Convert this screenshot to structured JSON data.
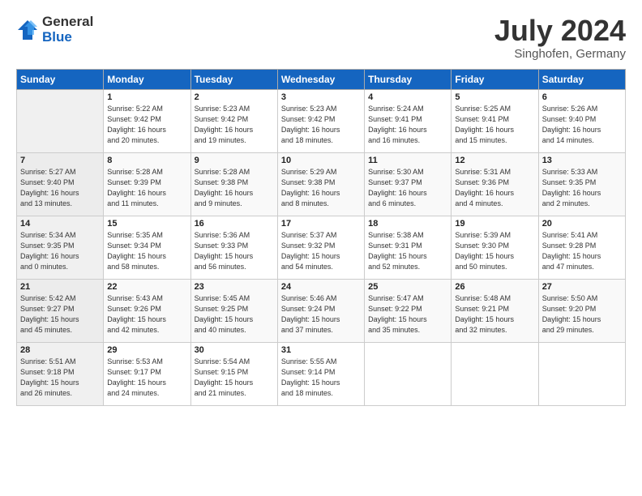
{
  "logo": {
    "general": "General",
    "blue": "Blue"
  },
  "title": "July 2024",
  "location": "Singhofen, Germany",
  "days_header": [
    "Sunday",
    "Monday",
    "Tuesday",
    "Wednesday",
    "Thursday",
    "Friday",
    "Saturday"
  ],
  "weeks": [
    [
      {
        "num": "",
        "info": ""
      },
      {
        "num": "1",
        "info": "Sunrise: 5:22 AM\nSunset: 9:42 PM\nDaylight: 16 hours\nand 20 minutes."
      },
      {
        "num": "2",
        "info": "Sunrise: 5:23 AM\nSunset: 9:42 PM\nDaylight: 16 hours\nand 19 minutes."
      },
      {
        "num": "3",
        "info": "Sunrise: 5:23 AM\nSunset: 9:42 PM\nDaylight: 16 hours\nand 18 minutes."
      },
      {
        "num": "4",
        "info": "Sunrise: 5:24 AM\nSunset: 9:41 PM\nDaylight: 16 hours\nand 16 minutes."
      },
      {
        "num": "5",
        "info": "Sunrise: 5:25 AM\nSunset: 9:41 PM\nDaylight: 16 hours\nand 15 minutes."
      },
      {
        "num": "6",
        "info": "Sunrise: 5:26 AM\nSunset: 9:40 PM\nDaylight: 16 hours\nand 14 minutes."
      }
    ],
    [
      {
        "num": "7",
        "info": "Sunrise: 5:27 AM\nSunset: 9:40 PM\nDaylight: 16 hours\nand 13 minutes."
      },
      {
        "num": "8",
        "info": "Sunrise: 5:28 AM\nSunset: 9:39 PM\nDaylight: 16 hours\nand 11 minutes."
      },
      {
        "num": "9",
        "info": "Sunrise: 5:28 AM\nSunset: 9:38 PM\nDaylight: 16 hours\nand 9 minutes."
      },
      {
        "num": "10",
        "info": "Sunrise: 5:29 AM\nSunset: 9:38 PM\nDaylight: 16 hours\nand 8 minutes."
      },
      {
        "num": "11",
        "info": "Sunrise: 5:30 AM\nSunset: 9:37 PM\nDaylight: 16 hours\nand 6 minutes."
      },
      {
        "num": "12",
        "info": "Sunrise: 5:31 AM\nSunset: 9:36 PM\nDaylight: 16 hours\nand 4 minutes."
      },
      {
        "num": "13",
        "info": "Sunrise: 5:33 AM\nSunset: 9:35 PM\nDaylight: 16 hours\nand 2 minutes."
      }
    ],
    [
      {
        "num": "14",
        "info": "Sunrise: 5:34 AM\nSunset: 9:35 PM\nDaylight: 16 hours\nand 0 minutes."
      },
      {
        "num": "15",
        "info": "Sunrise: 5:35 AM\nSunset: 9:34 PM\nDaylight: 15 hours\nand 58 minutes."
      },
      {
        "num": "16",
        "info": "Sunrise: 5:36 AM\nSunset: 9:33 PM\nDaylight: 15 hours\nand 56 minutes."
      },
      {
        "num": "17",
        "info": "Sunrise: 5:37 AM\nSunset: 9:32 PM\nDaylight: 15 hours\nand 54 minutes."
      },
      {
        "num": "18",
        "info": "Sunrise: 5:38 AM\nSunset: 9:31 PM\nDaylight: 15 hours\nand 52 minutes."
      },
      {
        "num": "19",
        "info": "Sunrise: 5:39 AM\nSunset: 9:30 PM\nDaylight: 15 hours\nand 50 minutes."
      },
      {
        "num": "20",
        "info": "Sunrise: 5:41 AM\nSunset: 9:28 PM\nDaylight: 15 hours\nand 47 minutes."
      }
    ],
    [
      {
        "num": "21",
        "info": "Sunrise: 5:42 AM\nSunset: 9:27 PM\nDaylight: 15 hours\nand 45 minutes."
      },
      {
        "num": "22",
        "info": "Sunrise: 5:43 AM\nSunset: 9:26 PM\nDaylight: 15 hours\nand 42 minutes."
      },
      {
        "num": "23",
        "info": "Sunrise: 5:45 AM\nSunset: 9:25 PM\nDaylight: 15 hours\nand 40 minutes."
      },
      {
        "num": "24",
        "info": "Sunrise: 5:46 AM\nSunset: 9:24 PM\nDaylight: 15 hours\nand 37 minutes."
      },
      {
        "num": "25",
        "info": "Sunrise: 5:47 AM\nSunset: 9:22 PM\nDaylight: 15 hours\nand 35 minutes."
      },
      {
        "num": "26",
        "info": "Sunrise: 5:48 AM\nSunset: 9:21 PM\nDaylight: 15 hours\nand 32 minutes."
      },
      {
        "num": "27",
        "info": "Sunrise: 5:50 AM\nSunset: 9:20 PM\nDaylight: 15 hours\nand 29 minutes."
      }
    ],
    [
      {
        "num": "28",
        "info": "Sunrise: 5:51 AM\nSunset: 9:18 PM\nDaylight: 15 hours\nand 26 minutes."
      },
      {
        "num": "29",
        "info": "Sunrise: 5:53 AM\nSunset: 9:17 PM\nDaylight: 15 hours\nand 24 minutes."
      },
      {
        "num": "30",
        "info": "Sunrise: 5:54 AM\nSunset: 9:15 PM\nDaylight: 15 hours\nand 21 minutes."
      },
      {
        "num": "31",
        "info": "Sunrise: 5:55 AM\nSunset: 9:14 PM\nDaylight: 15 hours\nand 18 minutes."
      },
      {
        "num": "",
        "info": ""
      },
      {
        "num": "",
        "info": ""
      },
      {
        "num": "",
        "info": ""
      }
    ]
  ]
}
